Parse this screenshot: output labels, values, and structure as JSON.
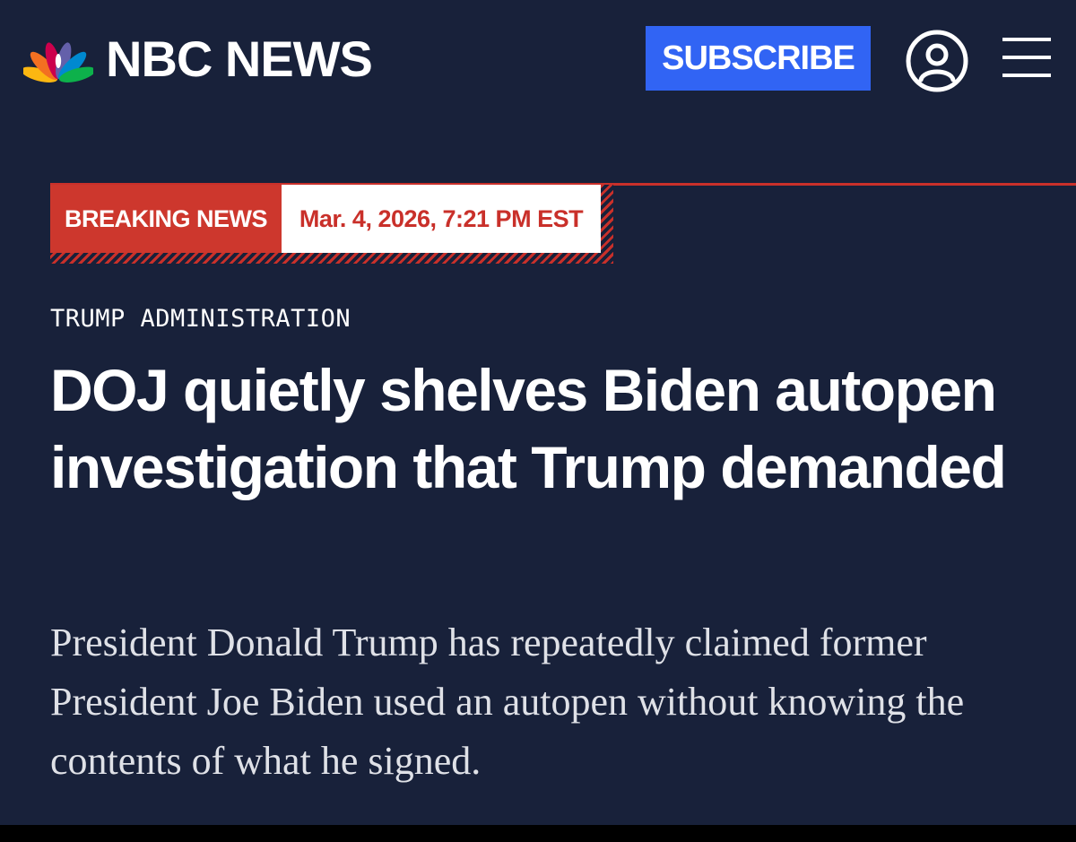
{
  "header": {
    "logo_text": "NBC NEWS",
    "subscribe_label": "SUBSCRIBE",
    "account_icon": "user-circle-icon",
    "menu_icon": "hamburger-menu-icon"
  },
  "banner": {
    "badge": "BREAKING NEWS",
    "timestamp": "Mar. 4, 2026, 7:21 PM EST"
  },
  "article": {
    "section": "TRUMP ADMINISTRATION",
    "headline": "DOJ quietly shelves Biden autopen investigation that Trump demanded",
    "dek": "President Donald Trump has repeatedly claimed former President Joe Biden used an autopen without knowing the contents of what he signed."
  },
  "colors": {
    "background": "#18213a",
    "subscribe_blue": "#3164f4",
    "breaking_red": "#cd372d",
    "text_white": "#ffffff"
  }
}
